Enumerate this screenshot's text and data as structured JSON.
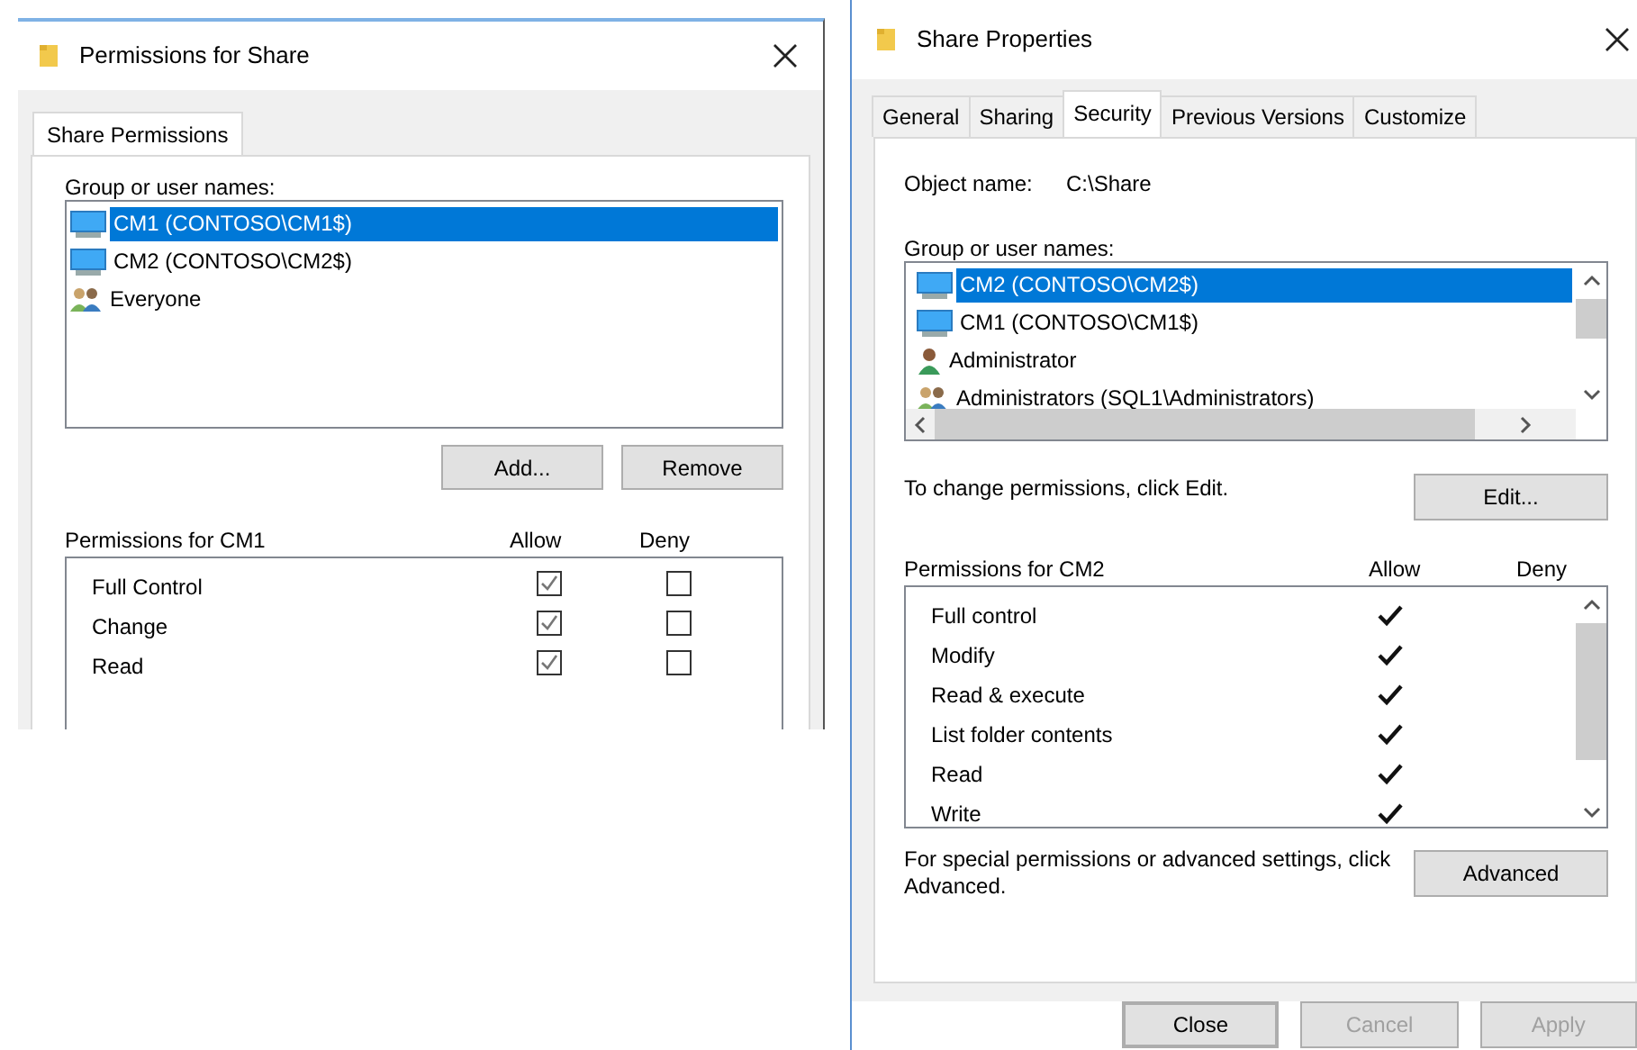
{
  "left_dialog": {
    "title": "Permissions for Share",
    "tabs": [
      {
        "label": "Share Permissions",
        "selected": true
      }
    ],
    "group_label": "Group or user names:",
    "users": [
      {
        "name": "CM1 (CONTOSO\\CM1$)",
        "kind": "computer",
        "selected": true
      },
      {
        "name": "CM2 (CONTOSO\\CM2$)",
        "kind": "computer",
        "selected": false
      },
      {
        "name": "Everyone",
        "kind": "group",
        "selected": false
      }
    ],
    "buttons": [
      "Add...",
      "Remove"
    ],
    "permissions_label": "Permissions for CM1",
    "allow_header": "Allow",
    "deny_header": "Deny",
    "permissions": [
      {
        "name": "Full Control",
        "allow": true,
        "deny": false
      },
      {
        "name": "Change",
        "allow": true,
        "deny": false
      },
      {
        "name": "Read",
        "allow": true,
        "deny": false
      }
    ]
  },
  "right_dialog": {
    "title": "Share Properties",
    "tabs": [
      {
        "label": "General",
        "selected": false
      },
      {
        "label": "Sharing",
        "selected": false
      },
      {
        "label": "Security",
        "selected": true
      },
      {
        "label": "Previous Versions",
        "selected": false
      },
      {
        "label": "Customize",
        "selected": false
      }
    ],
    "object_name_label": "Object name:",
    "object_name": "C:\\Share",
    "group_label": "Group or user names:",
    "users": [
      {
        "name": "CM2 (CONTOSO\\CM2$)",
        "kind": "computer",
        "selected": true
      },
      {
        "name": "CM1 (CONTOSO\\CM1$)",
        "kind": "computer",
        "selected": false
      },
      {
        "name": "Administrator",
        "kind": "user",
        "selected": false
      },
      {
        "name": "Administrators (SQL1\\Administrators)",
        "kind": "group",
        "selected": false
      }
    ],
    "edit_hint": "To change permissions, click Edit.",
    "edit_button": "Edit...",
    "permissions_label": "Permissions for CM2",
    "allow_header": "Allow",
    "deny_header": "Deny",
    "permissions": [
      {
        "name": "Full control",
        "allow": true,
        "deny": false
      },
      {
        "name": "Modify",
        "allow": true,
        "deny": false
      },
      {
        "name": "Read & execute",
        "allow": true,
        "deny": false
      },
      {
        "name": "List folder contents",
        "allow": true,
        "deny": false
      },
      {
        "name": "Read",
        "allow": true,
        "deny": false
      },
      {
        "name": "Write",
        "allow": true,
        "deny": false
      }
    ],
    "advanced_hint": "For special permissions or advanced settings, click Advanced.",
    "advanced_button": "Advanced",
    "footer_buttons": [
      {
        "label": "Close",
        "default": true,
        "disabled": false
      },
      {
        "label": "Cancel",
        "default": false,
        "disabled": true
      },
      {
        "label": "Apply",
        "default": false,
        "disabled": true
      }
    ]
  }
}
